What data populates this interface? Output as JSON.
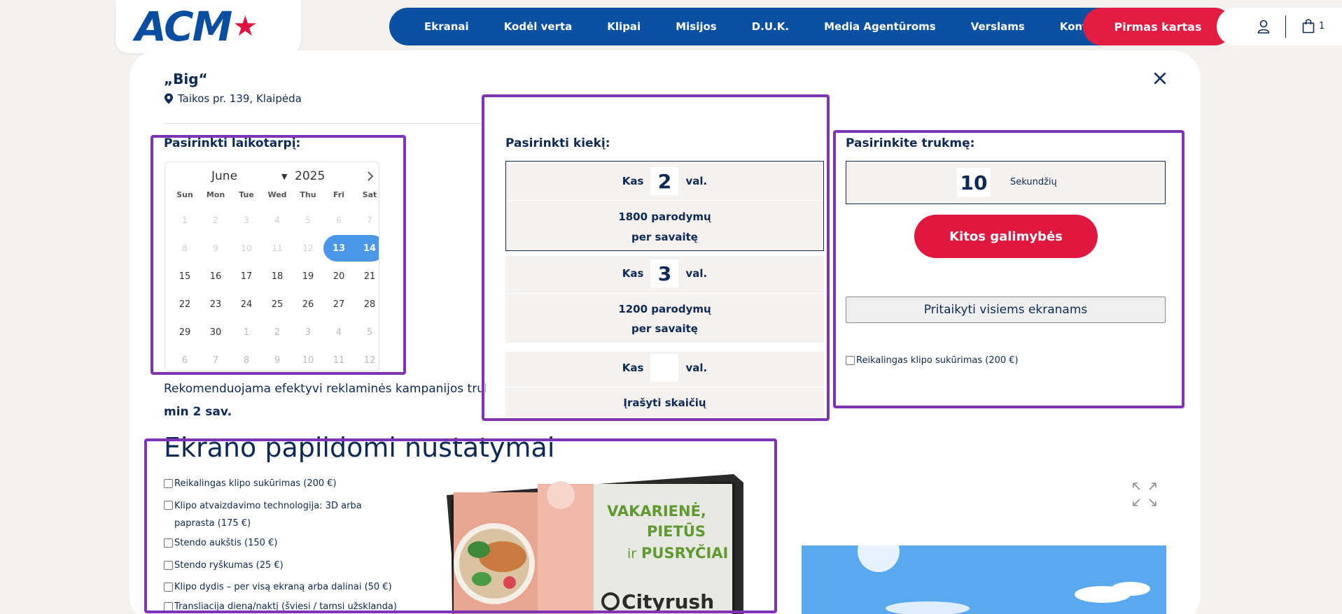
{
  "header": {
    "logo": "ACM",
    "nav": [
      "Ekranai",
      "Kodėl verta",
      "Klipai",
      "Misijos",
      "D.U.K.",
      "Media Agentūroms",
      "Verslams",
      "Kontaktai"
    ],
    "cta": "Pirmas kartas",
    "cart_count": "1",
    "colors": {
      "nav": "#0b51a3",
      "cta": "#e31c43",
      "highlight": "#7f34b6"
    }
  },
  "screen": {
    "title": "„Big“",
    "address": "Taikos pr. 139, Klaipėda"
  },
  "period": {
    "label": "Pasirinkti laikotarpį:",
    "month": "June",
    "year": "2025",
    "weekdays": [
      "Sun",
      "Mon",
      "Tue",
      "Wed",
      "Thu",
      "Fri",
      "Sat"
    ],
    "weeks": [
      [
        "1",
        "2",
        "3",
        "4",
        "5",
        "6",
        "7"
      ],
      [
        "8",
        "9",
        "10",
        "11",
        "12",
        "13",
        "14"
      ],
      [
        "15",
        "16",
        "17",
        "18",
        "19",
        "20",
        "21"
      ],
      [
        "22",
        "23",
        "24",
        "25",
        "26",
        "27",
        "28"
      ],
      [
        "29",
        "30",
        "1",
        "2",
        "3",
        "4",
        "5"
      ],
      [
        "6",
        "7",
        "8",
        "9",
        "10",
        "11",
        "12"
      ]
    ],
    "selected": [
      "13",
      "14"
    ],
    "recommendation": "Rekomenduojama efektyvi reklaminės kampanijos trukmė",
    "recommendation_value": "min 2 sav."
  },
  "frequency": {
    "label": "Pasirinkti kiekį:",
    "options": [
      {
        "prefix": "Kas",
        "value": "2",
        "suffix": "val.",
        "line1": "1800 parodymų",
        "line2": "per savaitę"
      },
      {
        "prefix": "Kas",
        "value": "3",
        "suffix": "val.",
        "line1": "1200 parodymų",
        "line2": "per savaitę"
      },
      {
        "prefix": "Kas",
        "value": "",
        "suffix": "val.",
        "line1": "Įrašyti skaičių",
        "line2": ""
      }
    ]
  },
  "duration": {
    "label": "Pasirinkite trukmę:",
    "value": "10",
    "unit": "Sekundžių",
    "more_button": "Kitos galimybės",
    "apply_all_button": "Pritaikyti visiems ekranams",
    "clip_checkbox": "Reikalingas klipo sukūrimas (200 €)"
  },
  "extra": {
    "heading": "Ekrano papildomi nustatymai",
    "options": [
      "Reikalingas klipo sukūrimas (200 €)",
      "Klipo atvaizdavimo technologija: 3D arba paprasta (175 €)",
      "Stendo aukštis (150 €)",
      "Stendo ryškumas (25 €)",
      "Klipo dydis – per visą ekraną arba dalinai (50 €)",
      "Transliacija dieną/naktį (šviesi / tamsi užsklanda)"
    ],
    "billboard": {
      "line1": "VAKARIENĖ,",
      "line2": "PIETŪS",
      "line3_a": "ir",
      "line3_b": "PUSRYČIAI",
      "brand": "Cityrush"
    }
  }
}
